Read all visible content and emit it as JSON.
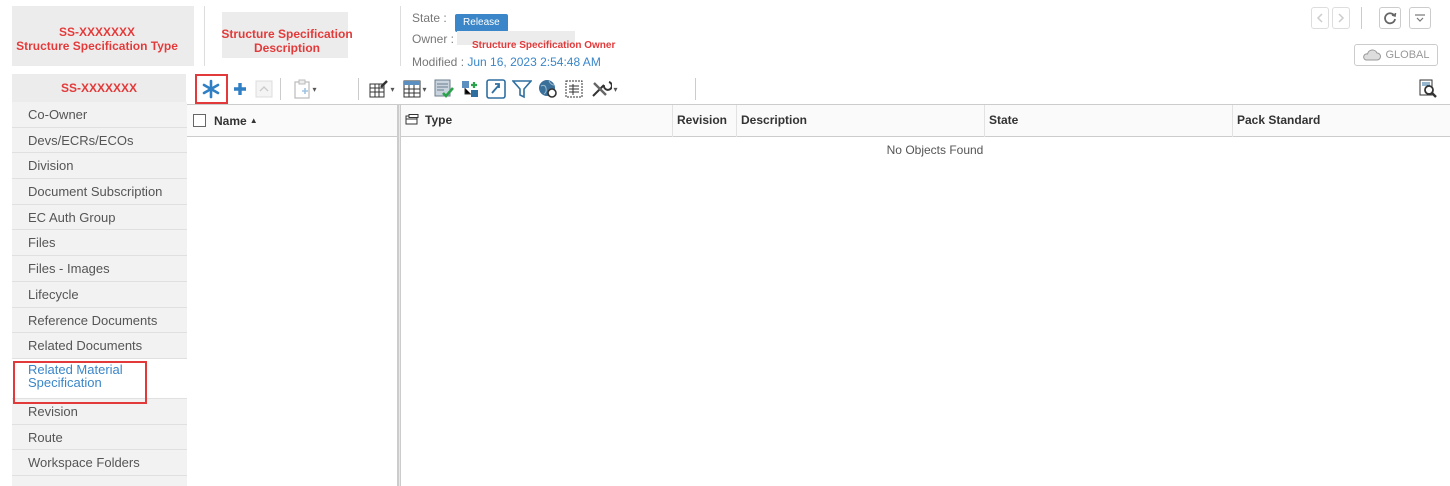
{
  "header": {
    "object_id": "SS-XXXXXXX",
    "object_type": "Structure Specification Type",
    "description_line1": "Structure Specification",
    "description_line2": "Description",
    "state_label": "State :",
    "state_value": "Release",
    "owner_label": "Owner :",
    "owner_value": "Structure Specification Owner",
    "modified_label": "Modified :",
    "modified_value": "Jun 16, 2023 2:54:48 AM",
    "global_label": "GLOBAL"
  },
  "sidebar": {
    "title": "SS-XXXXXXX",
    "items": [
      {
        "label": "Co-Owner"
      },
      {
        "label": "Devs/ECRs/ECOs"
      },
      {
        "label": "Division"
      },
      {
        "label": "Document Subscription"
      },
      {
        "label": "EC Auth Group"
      },
      {
        "label": "Files"
      },
      {
        "label": "Files - Images"
      },
      {
        "label": "Lifecycle"
      },
      {
        "label": "Reference Documents"
      },
      {
        "label": "Related Documents"
      },
      {
        "label": "Related Material Specification"
      },
      {
        "label": "Revision"
      },
      {
        "label": "Route"
      },
      {
        "label": "Workspace Folders"
      }
    ],
    "active_index": 10
  },
  "left_pane": {
    "column": "Name"
  },
  "grid": {
    "columns": [
      "Type",
      "Revision",
      "Description",
      "State",
      "Pack Standard"
    ],
    "empty_message": "No Objects Found"
  },
  "colors": {
    "accent": "#3a86c8",
    "highlight": "#e23a3a",
    "redaction": "#ececec"
  }
}
